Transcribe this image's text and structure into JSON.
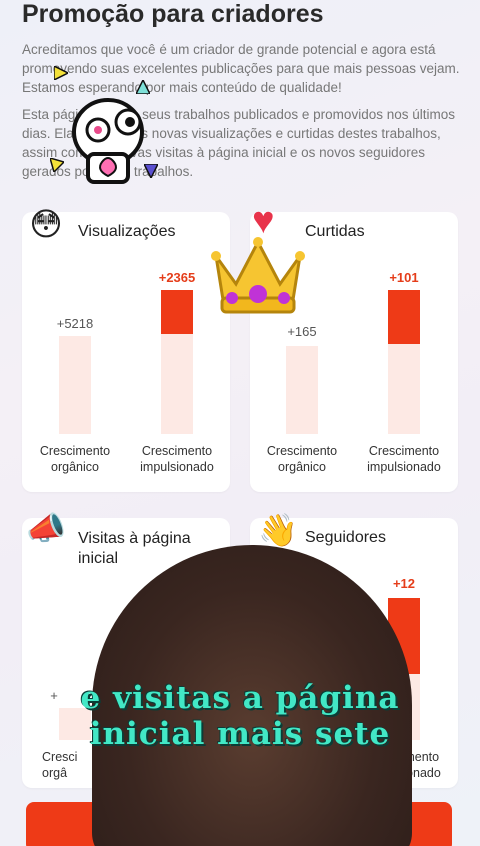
{
  "header": {
    "title": "Promoção para criadores",
    "paragraph1": "Acreditamos que você é um criador de grande potencial e agora está promovendo suas excelentes publicações para que mais pessoas vejam. Estamos esperando por mais conteúdo de qualidade!",
    "paragraph2": "Esta página mostra seus trabalhos publicados e promovidos nos últimos dias. Ela compara as novas visualizações e curtidas destes trabalhos, assim como as novas visitas à página inicial e os novos seguidores gerados por estes trabalhos."
  },
  "cards": {
    "views": {
      "title": "Visualizações",
      "icon": "astonished-face-icon",
      "organic_value": "+5218",
      "boosted_value": "+2365",
      "organic_label": "Crescimento orgânico",
      "boosted_label": "Crescimento impulsionado"
    },
    "likes": {
      "title": "Curtidas",
      "icon": "heart-icon",
      "organic_value": "+165",
      "boosted_value": "+101",
      "organic_label": "Crescimento orgânico",
      "boosted_label": "Crescimento impulsionado"
    },
    "profile_visits": {
      "title": "Visitas à página inicial",
      "icon": "megaphone-icon",
      "organic_value": "+",
      "organic_label": "Cresci orgâ"
    },
    "followers": {
      "title": "Seguidores",
      "icon": "waving-hand-icon",
      "boosted_value": "+12",
      "boosted_label": "Crescimento impulsionado"
    }
  },
  "overlay": {
    "caption": "e visitas a página inicial mais sete"
  },
  "colors": {
    "accent": "#ee3a17",
    "bar_light": "#fde9e4",
    "caption": "#42e8c6"
  }
}
